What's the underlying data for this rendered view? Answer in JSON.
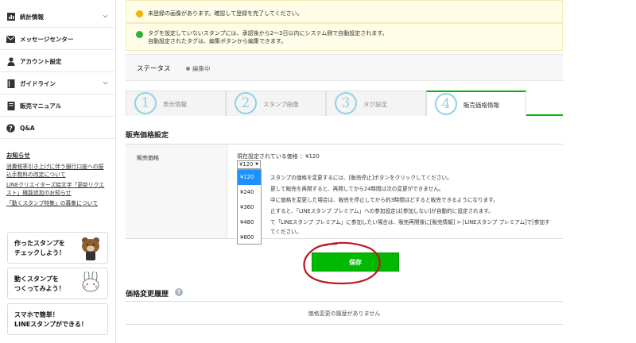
{
  "sidebar": {
    "items": [
      {
        "label": "統計情報",
        "icon": "bar-chart-icon",
        "has_chevron": true
      },
      {
        "label": "メッセージセンター",
        "icon": "envelope-icon",
        "has_chevron": false
      },
      {
        "label": "アカウント設定",
        "icon": "user-icon",
        "has_chevron": false
      },
      {
        "label": "ガイドライン",
        "icon": "book-icon",
        "has_chevron": true
      },
      {
        "label": "販売マニュアル",
        "icon": "manual-icon",
        "has_chevron": false
      },
      {
        "label": "Q&A",
        "icon": "question-icon",
        "has_chevron": false
      }
    ],
    "notices_heading": "お知らせ",
    "notices": [
      "消費税率引き上げに伴う銀行口座への振込手数料の改定について",
      "LINEクリエイターズ絵文字「更新リクエスト」機能追加のお知らせ",
      "「動くスタンプ特集」の募集について"
    ],
    "promos": [
      {
        "text": "作ったスタンプを\nチェックしよう！"
      },
      {
        "text": "動くスタンプを\nつくってみよう！"
      },
      {
        "text": "スマホで簡単！\nLINEスタンプができる！"
      }
    ]
  },
  "alerts": [
    {
      "text": "未登録の画像があります。確認して登録を完了してください。",
      "color": "#f5b400"
    },
    {
      "text": "タグを設定していないスタンプには、承認後から2〜3日以内にシステム側で自動設定されます。\n自動設定されたタグは、編集ボタンから編集できます。",
      "color": "#2ab23b"
    }
  ],
  "status": {
    "label": "ステータス",
    "value": "編集中"
  },
  "tabs": [
    {
      "num": "1",
      "label": "表示情報"
    },
    {
      "num": "2",
      "label": "スタンプ画像"
    },
    {
      "num": "3",
      "label": "タグ設定"
    },
    {
      "num": "4",
      "label": "販売価格情報"
    }
  ],
  "pricing": {
    "section_title": "販売価格設定",
    "row_label": "販売価格",
    "current": "現在設定されている価格 ：¥120",
    "selected": "¥120",
    "options": [
      "¥120",
      "¥240",
      "¥360",
      "¥480",
      "¥600"
    ],
    "info_lines": [
      "スタンプの価格を変更するには、[販売停止]ボタンをクリックしてください。",
      "更して販売を再開すると、再開してから24時間は次の変更ができません。",
      "中に価格を変更した場合は、販売を停止してから約3時間ほどすると販売できるようになります。",
      "止すると、「LINEスタンプ プレミアム」への参加設定は[参加しない]が自動的に設定されます。",
      "て「LINEスタンプ プレミアム」に参加したい場合は、販売再開後に[販売情報] > [LINEスタンプ プレミアム]で[参加す",
      "てください。"
    ]
  },
  "save_label": "保存",
  "history": {
    "title": "価格変更履歴",
    "empty": "価格変更の履歴がありません"
  },
  "colors": {
    "accent": "#00b900",
    "annotation": "#c0141e",
    "tab_number": "#8fd2e6"
  }
}
